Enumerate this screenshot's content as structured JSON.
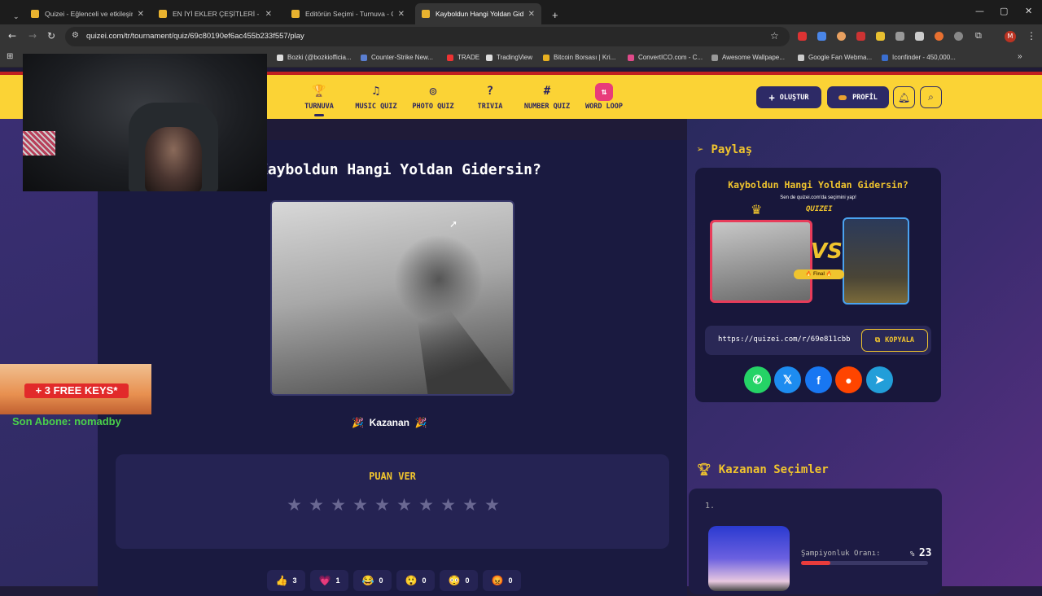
{
  "browser": {
    "tabs": [
      {
        "title": "Quizei - Eğlenceli ve etkileşimli",
        "active": false,
        "color": "#e9b32f"
      },
      {
        "title": "EN İYİ EKLER ÇEŞİTLERİ - Tier Li",
        "active": false,
        "color": "#e9b32f"
      },
      {
        "title": "Editörün Seçimi - Turnuva - Qui",
        "active": false,
        "color": "#e9b32f"
      },
      {
        "title": "Kayboldun Hangi Yoldan Giders",
        "active": true,
        "color": "#e9b32f"
      }
    ],
    "url": "quizei.com/tr/tournament/quiz/69c80190ef6ac455b233f557/play",
    "bookmarks": [
      "Bozki (@bozkiofficia...",
      "Counter-Strike New...",
      "TRADE",
      "TradingView",
      "Bitcoin Borsası | Kri...",
      "ConvertICO.com - C...",
      "Awesome Wallpape...",
      "Google Fan Webma...",
      "Iconfinder - 450,000..."
    ],
    "profile_initial": "M",
    "new_tab_icon": "+",
    "more_bookmarks_icon": "»"
  },
  "header": {
    "nav": [
      {
        "label": "TURNUVA",
        "icon": "trophy-icon",
        "glyph": "🏆"
      },
      {
        "label": "MUSIC QUIZ",
        "icon": "music-icon",
        "glyph": "♫"
      },
      {
        "label": "PHOTO QUIZ",
        "icon": "camera-icon",
        "glyph": "◎"
      },
      {
        "label": "TRIVIA",
        "icon": "question-icon",
        "glyph": "?"
      },
      {
        "label": "NUMBER QUIZ",
        "icon": "hash-icon",
        "glyph": "#"
      },
      {
        "label": "WORD LOOP",
        "icon": "sort-icon",
        "glyph": "⇅"
      }
    ],
    "create_label": "OLUŞTUR",
    "create_icon": "+",
    "profile_label": "PROFİL",
    "accent_color": "#fbd335",
    "brand_dark": "#2b2561"
  },
  "main": {
    "title": "Kayboldun Hangi Yoldan Gidersin?",
    "winner_label": "Kazanan",
    "winner_emoji": "🎉",
    "rate_title": "PUAN VER",
    "star_count": 10,
    "reactions": [
      {
        "emoji": "👍",
        "count": "3"
      },
      {
        "emoji": "💗",
        "count": "1"
      },
      {
        "emoji": "😂",
        "count": "0"
      },
      {
        "emoji": "😲",
        "count": "0"
      },
      {
        "emoji": "😳",
        "count": "0"
      },
      {
        "emoji": "😡",
        "count": "0"
      }
    ]
  },
  "share": {
    "title": "Paylaş",
    "card_title": "Kayboldun Hangi Yoldan Gidersin?",
    "card_sub": "Sen de quizei.com'da seçimini yap!",
    "brand": "QUIZEI",
    "vs": "VS",
    "final_label": "🔥 Final 🔥",
    "link": "https://quizei.com/r/69e811cbb",
    "copy_label": "KOPYALA",
    "socials": [
      {
        "name": "whatsapp",
        "glyph": "✆",
        "color": "#25d366"
      },
      {
        "name": "x",
        "glyph": "𝕏",
        "color": "#1d8cf0"
      },
      {
        "name": "facebook",
        "glyph": "f",
        "color": "#1877f2"
      },
      {
        "name": "reddit",
        "glyph": "●",
        "color": "#ff4500"
      },
      {
        "name": "telegram",
        "glyph": "➤",
        "color": "#229ed9"
      }
    ]
  },
  "winners": {
    "title": "Kazanan Seçimler",
    "rank": "1.",
    "champ_label": "Şampiyonluk Oranı:",
    "champ_prefix": "%",
    "champ_value": "23",
    "champ_fraction": 0.23
  },
  "overlay": {
    "keys_banner": "+ 3 FREE KEYS*",
    "last_sub": "Son Abone: nomadby"
  }
}
